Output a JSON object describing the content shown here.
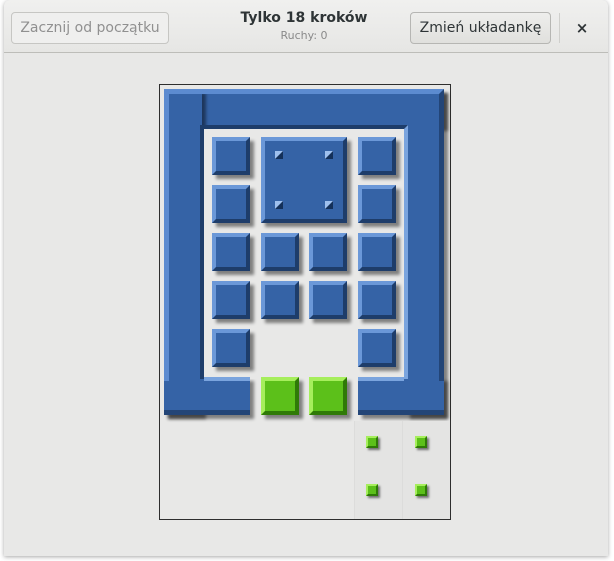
{
  "header": {
    "restart_label": "Zacznij od początku",
    "title": "Tylko 18 kroków",
    "moves": "Ruchy: 0",
    "change_label": "Zmień układankę",
    "close_glyph": "×"
  },
  "icons": {
    "close": "close-icon",
    "tile_corner": "tile-corner-mark-icon"
  },
  "colors": {
    "tile_blue": "#3563a6",
    "tile_green": "#5cc01a",
    "background": "#e8e8e7"
  }
}
